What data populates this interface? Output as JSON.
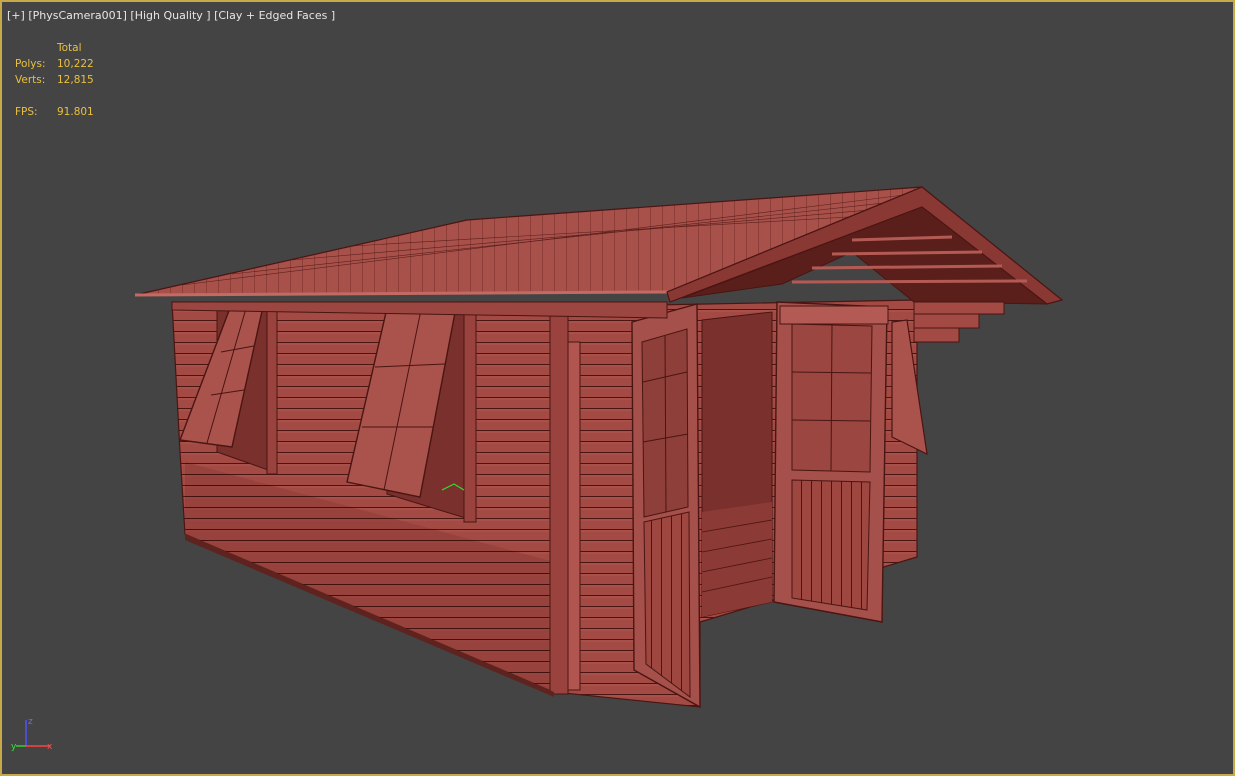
{
  "viewport": {
    "menu_plus": "[+]",
    "camera": "[PhysCamera001]",
    "quality": "[High Quality ]",
    "shading": "[Clay + Edged Faces ]"
  },
  "stats": {
    "header": "Total",
    "polys_label": "Polys:",
    "polys_value": "10,222",
    "verts_label": "Verts:",
    "verts_value": "12,815",
    "fps_label": "FPS:",
    "fps_value": "91.801"
  },
  "axis": {
    "x": "x",
    "y": "y",
    "z": "z"
  },
  "colors": {
    "background": "#444444",
    "viewport_border": "#c8a94a",
    "stats_text": "#e8c040",
    "clay": "#a34a44",
    "clay_dark": "#6e2a26",
    "edge": "#4a1512"
  }
}
